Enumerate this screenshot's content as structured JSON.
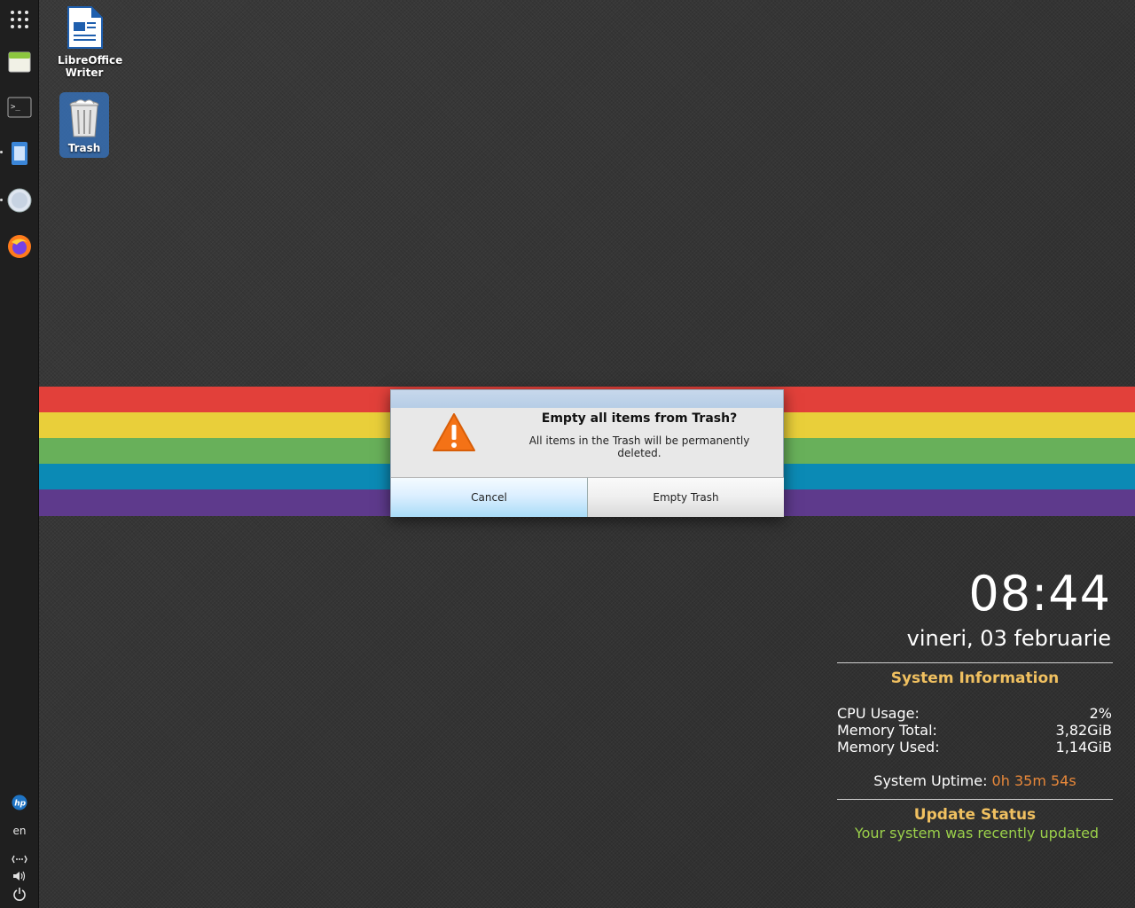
{
  "dock": {
    "items": [
      {
        "name": "apps-grid-icon"
      },
      {
        "name": "window-icon"
      },
      {
        "name": "terminal-icon"
      },
      {
        "name": "file-manager-icon"
      },
      {
        "name": "web-browser-icon"
      },
      {
        "name": "firefox-icon"
      }
    ],
    "bottom": {
      "lang": "en",
      "network": "network-icon",
      "volume": "volume-icon",
      "power": "power-icon",
      "vendor": "hp"
    }
  },
  "desktop": {
    "icons": [
      {
        "label_line1": "LibreOffice",
        "label_line2": "Writer"
      },
      {
        "label_line1": "Trash"
      }
    ]
  },
  "dialog": {
    "title": "Empty all items from Trash?",
    "message": "All items in the Trash will be permanently deleted.",
    "cancel_label": "Cancel",
    "confirm_label": "Empty Trash"
  },
  "widget": {
    "time": "08:44",
    "date": "vineri, 03 februarie",
    "sysinfo_title": "System Information",
    "rows": [
      {
        "label": "CPU Usage:",
        "value": "2%"
      },
      {
        "label": "Memory Total:",
        "value": "3,82GiB"
      },
      {
        "label": "Memory Used:",
        "value": "1,14GiB"
      }
    ],
    "uptime_label": "System Uptime:",
    "uptime_value": "0h 35m 54s",
    "update_title": "Update Status",
    "update_message": "Your system was recently updated"
  },
  "colors": {
    "rainbow": [
      "#e2403a",
      "#e9cf3a",
      "#68b05a",
      "#0b8ab5",
      "#5e3a8c"
    ],
    "accent_title": "#f0c060",
    "uptime": "#e8883a",
    "update_ok": "#9bd04a"
  }
}
